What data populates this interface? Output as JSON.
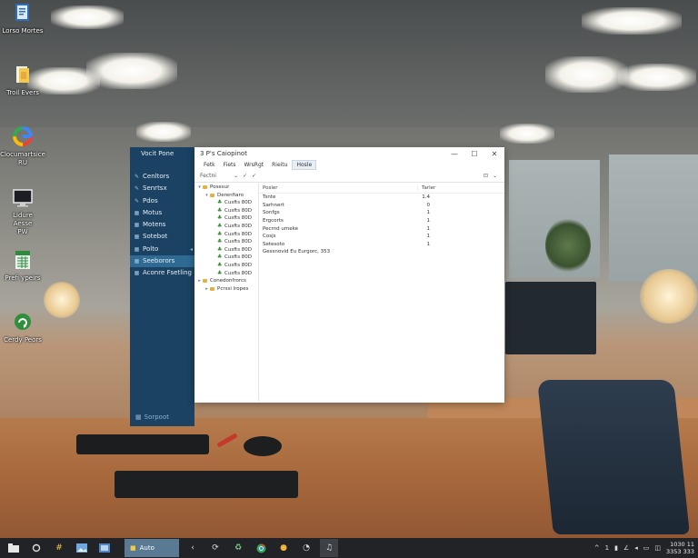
{
  "desktop": {
    "icons": [
      {
        "label": "Lorso Mortes",
        "icon": "document-icon"
      },
      {
        "label": "Troil Evers",
        "icon": "folder-icon"
      },
      {
        "label": "Clocumartsice\nRU",
        "icon": "google-icon"
      },
      {
        "label": "Lidure Aesse\nPW",
        "icon": "monitor-icon"
      },
      {
        "label": "Prefi ypeirs",
        "icon": "spreadsheet-icon"
      },
      {
        "label": "Cerdy Peors",
        "icon": "recycle-icon"
      }
    ]
  },
  "window": {
    "sidebar_title": "Vocit Pone",
    "title": "3 P's Caiopinot",
    "menu": [
      "Fetk",
      "Fiets",
      "WrsRgt",
      "Rieitu",
      "Hosle"
    ],
    "active_menu": "Hosle",
    "toolbar_label": "Fectni",
    "sidebar_items": [
      "Cenltors",
      "Senrtsx",
      "Pdos",
      "Motus",
      "Motens",
      "Sotebot",
      "Polto",
      "Seeborors",
      "Aconre Fsetling"
    ],
    "active_sidebar": "Seeborors",
    "sidebar_footer": "Sorpoot",
    "tree": [
      {
        "label": "Posesur",
        "type": "folder",
        "depth": 0,
        "toggle": "▾"
      },
      {
        "label": "Derenfiaro",
        "type": "folder",
        "depth": 1,
        "toggle": "▾"
      },
      {
        "label": "Cusfts 80D",
        "type": "leaf",
        "depth": 2
      },
      {
        "label": "Cusfts 80D",
        "type": "leaf",
        "depth": 2
      },
      {
        "label": "Cusfts 80D",
        "type": "leaf",
        "depth": 2
      },
      {
        "label": "Cusfts 80D",
        "type": "leaf",
        "depth": 2
      },
      {
        "label": "Cusfts 80D",
        "type": "leaf",
        "depth": 2
      },
      {
        "label": "Cusfts 80D",
        "type": "leaf",
        "depth": 2
      },
      {
        "label": "Cusfts 80D",
        "type": "leaf",
        "depth": 2
      },
      {
        "label": "Cusfts 80D",
        "type": "leaf",
        "depth": 2
      },
      {
        "label": "Cusfts 80D",
        "type": "leaf",
        "depth": 2
      },
      {
        "label": "Cusfts 80D",
        "type": "leaf",
        "depth": 2
      },
      {
        "label": "Conedonfrorcs",
        "type": "folder",
        "depth": 0,
        "toggle": "▸"
      },
      {
        "label": "Pcrssi lropes",
        "type": "folder",
        "depth": 1,
        "toggle": "▸"
      }
    ],
    "columns": [
      "Posler",
      "Tarler"
    ],
    "rows": [
      {
        "name": "Tsnte",
        "value": "1.4"
      },
      {
        "name": "Sarhnert",
        "value": "0"
      },
      {
        "name": "Sonfgs",
        "value": "1"
      },
      {
        "name": "Ergcorts",
        "value": "1"
      },
      {
        "name": "Pecrnd umeke",
        "value": "1"
      },
      {
        "name": "Cosjs",
        "value": "1"
      },
      {
        "name": "Setesoto",
        "value": "1"
      },
      {
        "name": "Gessnovid Eu Eurgorc, 353",
        "value": ""
      }
    ]
  },
  "taskbar": {
    "active_app": "Auto",
    "tray_text": "1",
    "time": "1030 11",
    "date": "3353 333"
  }
}
